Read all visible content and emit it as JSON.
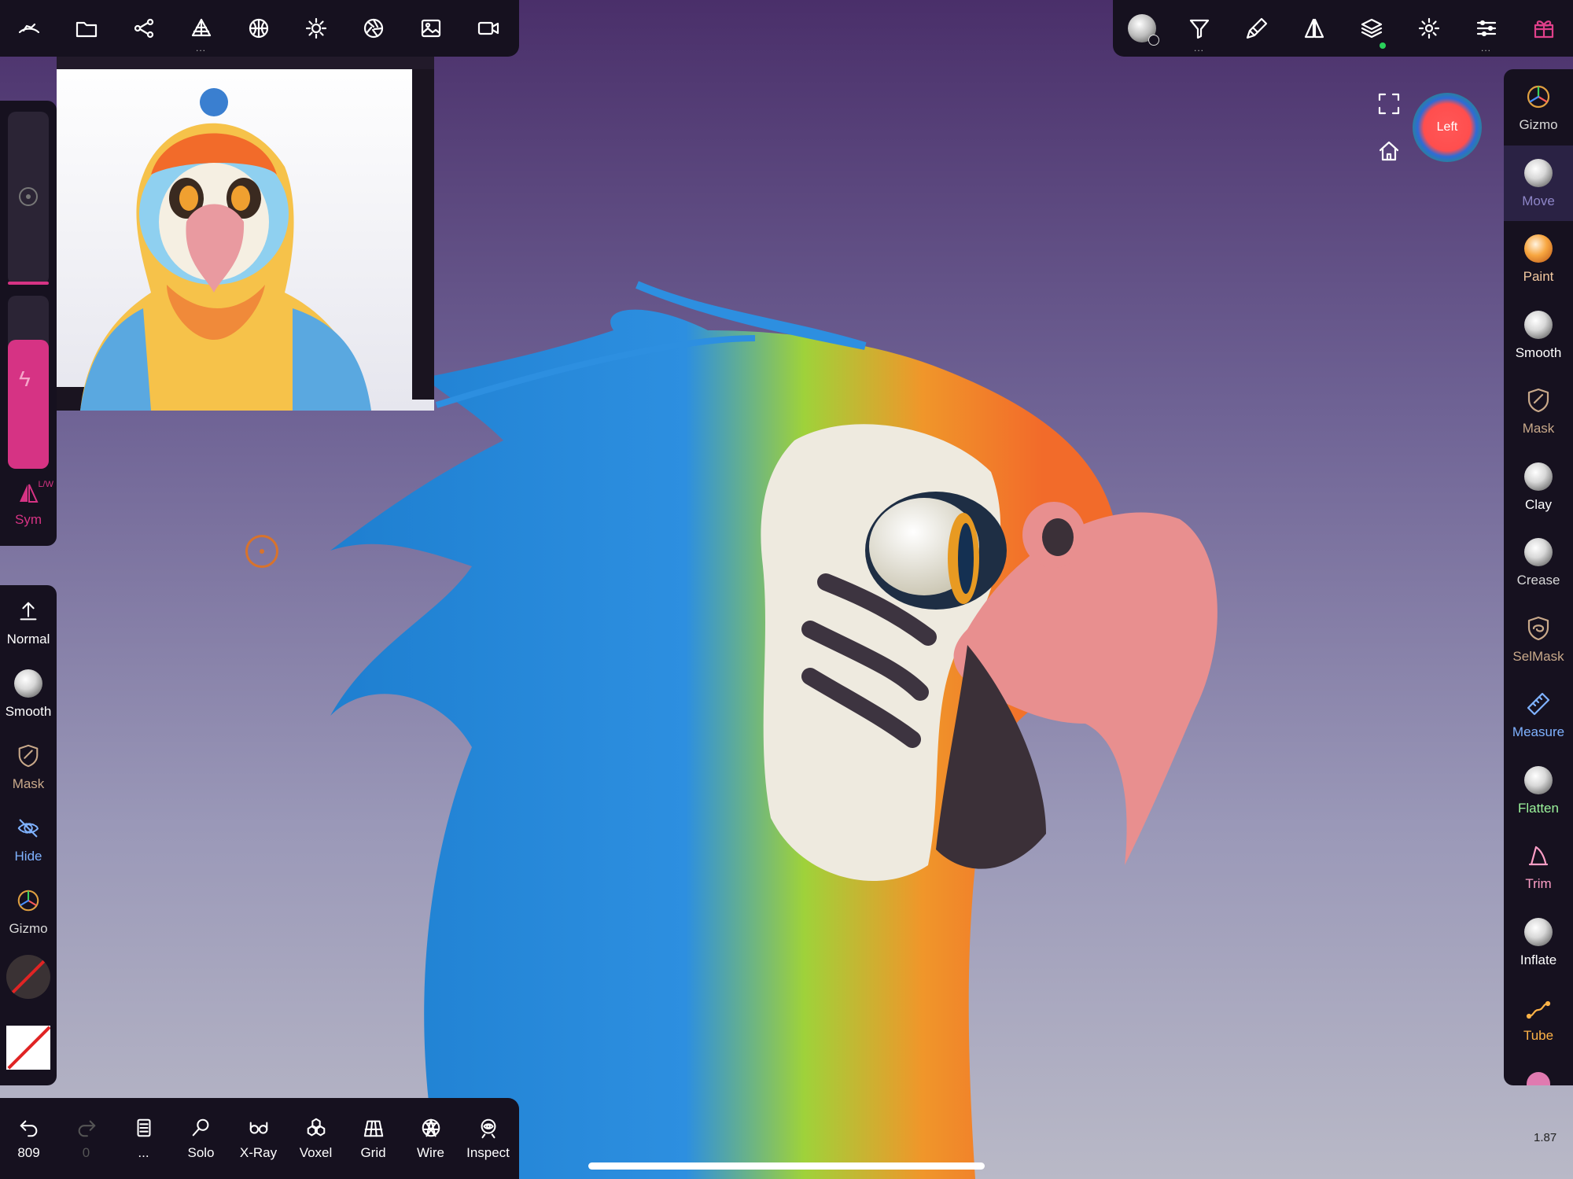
{
  "top_left_toolbar": [
    {
      "name": "nomad-logo-icon",
      "dots": false
    },
    {
      "name": "folder-icon",
      "dots": false
    },
    {
      "name": "scene-graph-icon",
      "dots": false
    },
    {
      "name": "topology-icon",
      "dots": true
    },
    {
      "name": "material-sphere-icon",
      "dots": false
    },
    {
      "name": "light-icon",
      "dots": false
    },
    {
      "name": "camera-aperture-icon",
      "dots": false
    },
    {
      "name": "image-icon",
      "dots": false
    },
    {
      "name": "video-camera-icon",
      "dots": false
    }
  ],
  "top_right_toolbar": [
    {
      "name": "matcap-sphere-icon",
      "dots": false
    },
    {
      "name": "filter-icon",
      "dots": true
    },
    {
      "name": "brush-tool-icon",
      "dots": false
    },
    {
      "name": "symmetry-icon",
      "dots": false
    },
    {
      "name": "layers-icon",
      "dots": false
    },
    {
      "name": "settings-gear-icon",
      "dots": false
    },
    {
      "name": "sliders-icon",
      "dots": true
    },
    {
      "name": "gift-icon",
      "dots": false
    }
  ],
  "right_tools": [
    {
      "label": "Gizmo",
      "color": "#d9d9d9",
      "icon": "gizmo-icon",
      "active": false
    },
    {
      "label": "Move",
      "color": "#8e86c8",
      "icon": "move-sphere-icon",
      "active": true
    },
    {
      "label": "Paint",
      "color": "#f3c9a0",
      "icon": "paint-sphere-icon",
      "active": false
    },
    {
      "label": "Smooth",
      "color": "#ffffff",
      "icon": "smooth-sphere-icon",
      "active": false
    },
    {
      "label": "Mask",
      "color": "#c9a98a",
      "icon": "mask-shield-icon",
      "active": false
    },
    {
      "label": "Clay",
      "color": "#ffffff",
      "icon": "clay-sphere-icon",
      "active": false
    },
    {
      "label": "Crease",
      "color": "#d9d9d9",
      "icon": "crease-sphere-icon",
      "active": false
    },
    {
      "label": "SelMask",
      "color": "#c9a98a",
      "icon": "selmask-shield-icon",
      "active": false
    },
    {
      "label": "Measure",
      "color": "#7fb2ff",
      "icon": "ruler-icon",
      "active": false
    },
    {
      "label": "Flatten",
      "color": "#9cf59c",
      "icon": "flatten-sphere-icon",
      "active": false
    },
    {
      "label": "Trim",
      "color": "#ff9fc7",
      "icon": "trim-icon",
      "active": false
    },
    {
      "label": "Inflate",
      "color": "#ffffff",
      "icon": "inflate-sphere-icon",
      "active": false
    },
    {
      "label": "Tube",
      "color": "#ffb347",
      "icon": "tube-icon",
      "active": false
    }
  ],
  "left_sliders": {
    "sym_label": "Sym",
    "sym_sub": "L/W"
  },
  "left_tools": [
    {
      "label": "Normal",
      "color": "#ffffff",
      "icon": "arrow-up-icon"
    },
    {
      "label": "Smooth",
      "color": "#ffffff",
      "icon": "smooth-sphere-icon"
    },
    {
      "label": "Mask",
      "color": "#c9a98a",
      "icon": "mask-shield-icon"
    },
    {
      "label": "Hide",
      "color": "#7fb2ff",
      "icon": "hide-icon"
    },
    {
      "label": "Gizmo",
      "color": "#d9d9d9",
      "icon": "gizmo-icon"
    }
  ],
  "bottom_bar": [
    {
      "label": "809",
      "icon": "undo-icon",
      "disabled": false
    },
    {
      "label": "0",
      "icon": "redo-icon",
      "disabled": true
    },
    {
      "label": "...",
      "icon": "document-icon",
      "disabled": false
    },
    {
      "label": "Solo",
      "icon": "search-icon",
      "disabled": false
    },
    {
      "label": "X-Ray",
      "icon": "glasses-icon",
      "disabled": false
    },
    {
      "label": "Voxel",
      "icon": "voxel-icon",
      "disabled": false
    },
    {
      "label": "Grid",
      "icon": "grid-icon",
      "disabled": false
    },
    {
      "label": "Wire",
      "icon": "wireframe-icon",
      "disabled": false
    },
    {
      "label": "Inspect",
      "icon": "eye-icon",
      "disabled": false
    }
  ],
  "view_cube_label": "Left",
  "zoom_value": "1.87"
}
